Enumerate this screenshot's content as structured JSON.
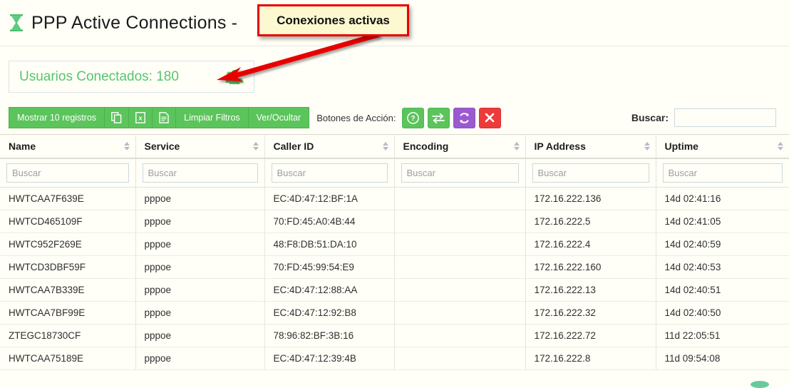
{
  "header": {
    "icon": "hourglass-icon",
    "title": "PPP Active Connections - "
  },
  "annotation": {
    "text": "Conexiones activas",
    "border_color": "#e80000",
    "background_color": "#fcf8cf"
  },
  "counter": {
    "label": "Usuarios Conectados: 180",
    "icon": "users-group-icon",
    "color": "#55c56e"
  },
  "toolbar": {
    "show_records_label": "Mostrar 10 registros",
    "copy_icon": "copy-icon",
    "excel_icon": "excel-export-icon",
    "pdf_icon": "document-export-icon",
    "clear_filters_label": "Limpiar Filtros",
    "show_hide_label": "Ver/Ocultar",
    "action_buttons_label": "Botones de Acción:",
    "actions": [
      {
        "name": "help-button",
        "icon": "question-circle-icon",
        "color": "#5bc45b"
      },
      {
        "name": "transfer-button",
        "icon": "exchange-arrows-icon",
        "color": "#5bc45b"
      },
      {
        "name": "refresh-button",
        "icon": "refresh-icon",
        "color": "#9b59d0"
      },
      {
        "name": "close-button",
        "icon": "close-x-icon",
        "color": "#eb3b3b"
      }
    ]
  },
  "search": {
    "label": "Buscar:",
    "value": "",
    "placeholder": ""
  },
  "table": {
    "columns": [
      {
        "label": "Name",
        "filter_placeholder": "Buscar",
        "filter_value": ""
      },
      {
        "label": "Service",
        "filter_placeholder": "Buscar",
        "filter_value": ""
      },
      {
        "label": "Caller ID",
        "filter_placeholder": "Buscar",
        "filter_value": ""
      },
      {
        "label": "Encoding",
        "filter_placeholder": "Buscar",
        "filter_value": ""
      },
      {
        "label": "IP Address",
        "filter_placeholder": "Buscar",
        "filter_value": ""
      },
      {
        "label": "Uptime",
        "filter_placeholder": "Buscar",
        "filter_value": ""
      }
    ],
    "rows": [
      [
        "HWTCAA7F639E",
        "pppoe",
        "EC:4D:47:12:BF:1A",
        "",
        "172.16.222.136",
        "14d 02:41:16"
      ],
      [
        "HWTCD465109F",
        "pppoe",
        "70:FD:45:A0:4B:44",
        "",
        "172.16.222.5",
        "14d 02:41:05"
      ],
      [
        "HWTC952F269E",
        "pppoe",
        "48:F8:DB:51:DA:10",
        "",
        "172.16.222.4",
        "14d 02:40:59"
      ],
      [
        "HWTCD3DBF59F",
        "pppoe",
        "70:FD:45:99:54:E9",
        "",
        "172.16.222.160",
        "14d 02:40:53"
      ],
      [
        "HWTCAA7B339E",
        "pppoe",
        "EC:4D:47:12:88:AA",
        "",
        "172.16.222.13",
        "14d 02:40:51"
      ],
      [
        "HWTCAA7BF99E",
        "pppoe",
        "EC:4D:47:12:92:B8",
        "",
        "172.16.222.32",
        "14d 02:40:50"
      ],
      [
        "ZTEGC18730CF",
        "pppoe",
        "78:96:82:BF:3B:16",
        "",
        "172.16.222.72",
        "11d 22:05:51"
      ],
      [
        "HWTCAA75189E",
        "pppoe",
        "EC:4D:47:12:39:4B",
        "",
        "172.16.222.8",
        "11d 09:54:08"
      ]
    ]
  }
}
